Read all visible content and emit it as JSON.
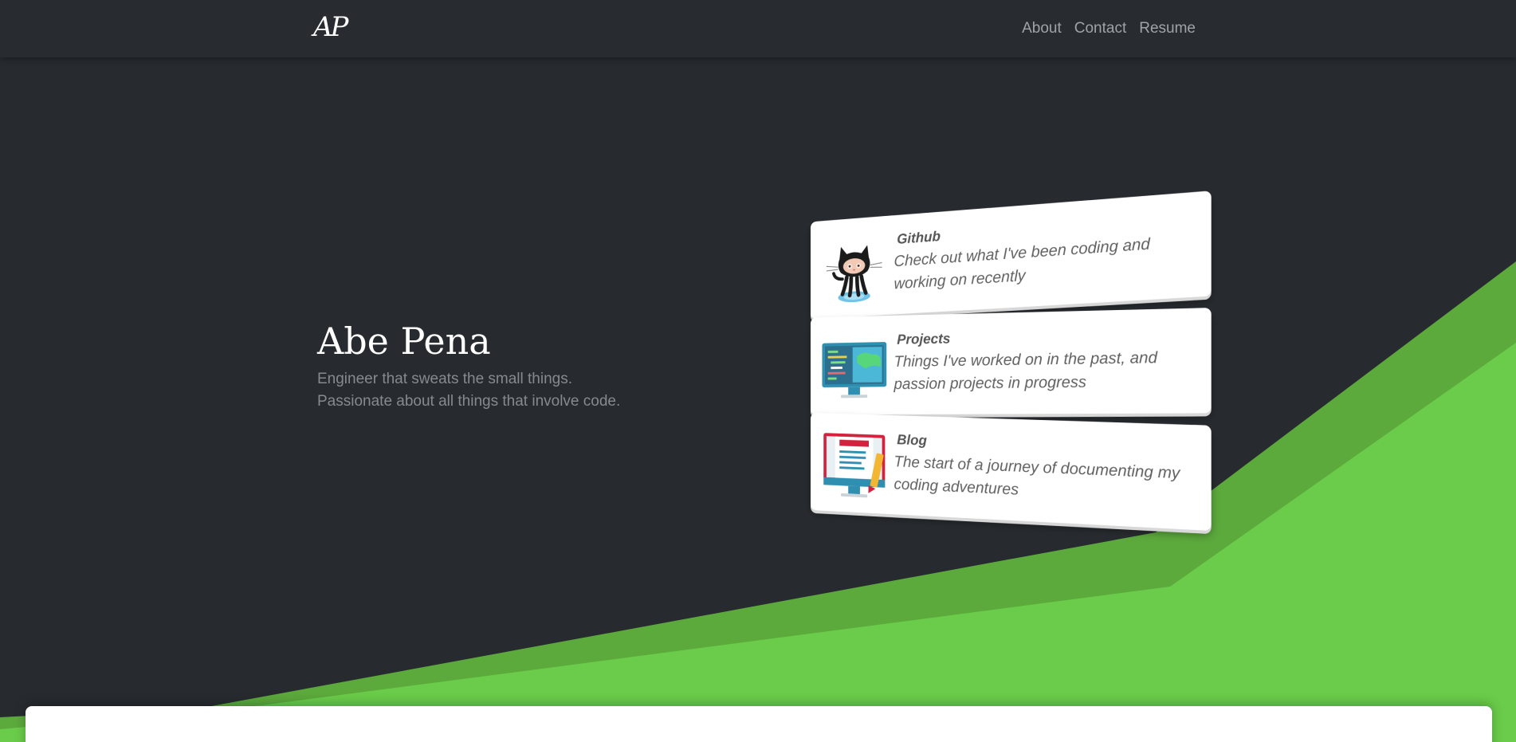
{
  "navbar": {
    "logo": "AP",
    "links": [
      {
        "label": "About"
      },
      {
        "label": "Contact"
      },
      {
        "label": "Resume"
      }
    ]
  },
  "hero": {
    "name": "Abe Pena",
    "tagline_line1": "Engineer that sweats the small things.",
    "tagline_line2": "Passionate about all things that involve code."
  },
  "cards": [
    {
      "title": "Github",
      "description": "Check out what I've been coding and working on recently",
      "icon": "github-octocat-icon"
    },
    {
      "title": "Projects",
      "description": "Things I've worked on in the past, and passion projects in progress",
      "icon": "monitor-code-icon"
    },
    {
      "title": "Blog",
      "description": "The start of a journey of documenting my coding adventures",
      "icon": "blog-document-icon"
    }
  ],
  "colors": {
    "background": "#272b2f",
    "navbar": "#282c30",
    "green_dark": "#5ca93c",
    "green_light": "#6acc4a",
    "card": "#ffffff",
    "muted_text": "#858a8f"
  }
}
